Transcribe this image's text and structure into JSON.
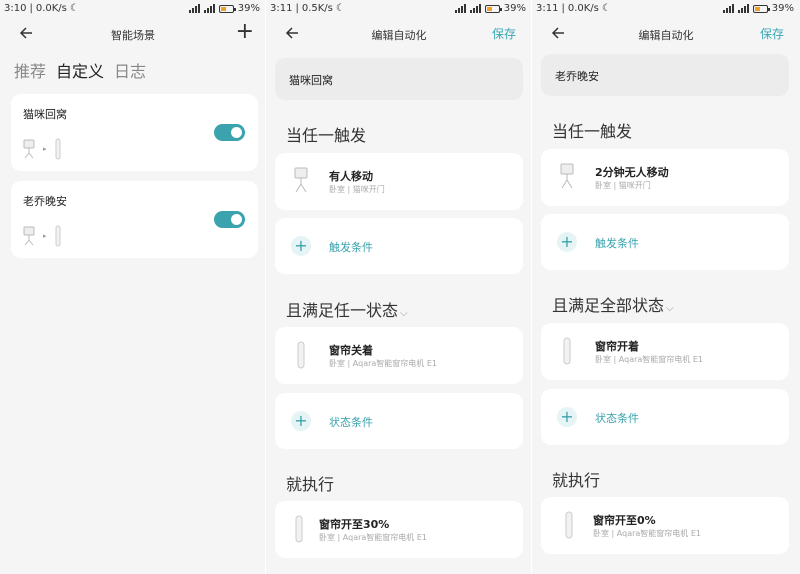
{
  "status_bar": {
    "p1": {
      "time": "3:10",
      "speed": "0.0K/s",
      "battery": "39%"
    },
    "p2": {
      "time": "3:11",
      "speed": "0.5K/s",
      "battery": "39%"
    },
    "p3": {
      "time": "3:11",
      "speed": "0.0K/s",
      "battery": "39%"
    }
  },
  "scenes_page": {
    "title": "智能场景",
    "tabs": [
      "推荐",
      "自定义",
      "日志"
    ],
    "active_tab": "自定义",
    "scenes": [
      {
        "name": "猫咪回窝",
        "enabled": true
      },
      {
        "name": "老乔晚安",
        "enabled": true
      }
    ]
  },
  "edit_page_1": {
    "title": "编辑自动化",
    "save_label": "保存",
    "name": "猫咪回窝",
    "trigger_section": "当任一触发",
    "trigger": {
      "title": "有人移动",
      "sub": "卧室 | 猫咪开门"
    },
    "add_trigger": "触发条件",
    "condition_section": "且满足任一状态",
    "condition": {
      "title": "窗帘关着",
      "sub": "卧室 | Aqara智能窗帘电机 E1"
    },
    "add_condition": "状态条件",
    "action_section": "就执行",
    "action": {
      "title": "窗帘开至30%",
      "sub": "卧室 | Aqara智能窗帘电机 E1"
    }
  },
  "edit_page_2": {
    "title": "编辑自动化",
    "save_label": "保存",
    "name": "老乔晚安",
    "trigger_section": "当任一触发",
    "trigger": {
      "title": "2分钟无人移动",
      "sub": "卧室 | 猫咪开门"
    },
    "add_trigger": "触发条件",
    "condition_section": "且满足全部状态",
    "condition": {
      "title": "窗帘开着",
      "sub": "卧室 | Aqara智能窗帘电机 E1"
    },
    "add_condition": "状态条件",
    "action_section": "就执行",
    "action": {
      "title": "窗帘开至0%",
      "sub": "卧室 | Aqara智能窗帘电机 E1"
    }
  },
  "colors": {
    "accent": "#3aa3ad",
    "background": "#f5f5f5",
    "card": "#ffffff"
  },
  "icons": [
    "back-arrow-icon",
    "plus-icon",
    "motion-sensor-icon",
    "curtain-motor-icon",
    "chevron-down-icon"
  ]
}
